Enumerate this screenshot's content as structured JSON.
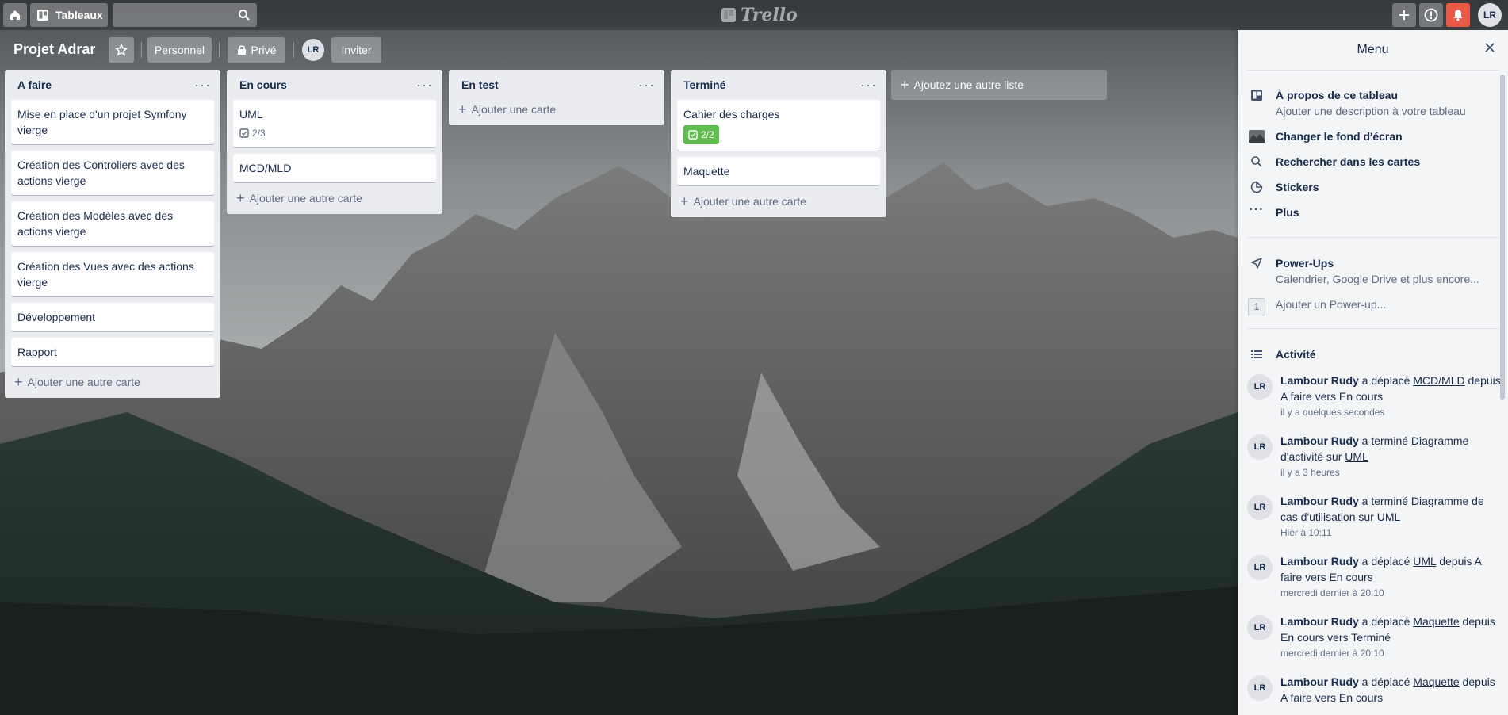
{
  "header": {
    "home_icon": "home-icon",
    "boards_label": "Tableaux",
    "search_value": "",
    "logo_text": "Trello",
    "user_initials": "LR"
  },
  "board": {
    "title": "Projet Adrar",
    "team_label": "Personnel",
    "visibility_label": "Privé",
    "member_initials": "LR",
    "invite_label": "Inviter"
  },
  "lists": [
    {
      "title": "A faire",
      "cards": [
        {
          "title": "Mise en place d'un projet Symfony vierge"
        },
        {
          "title": "Création des Controllers avec des actions vierge"
        },
        {
          "title": "Création des Modèles avec des actions vierge"
        },
        {
          "title": "Création des Vues avec des actions vierge"
        },
        {
          "title": "Développement"
        },
        {
          "title": "Rapport"
        }
      ],
      "add_card": "Ajouter une autre carte"
    },
    {
      "title": "En cours",
      "cards": [
        {
          "title": "UML",
          "checklist": "2/3"
        },
        {
          "title": "MCD/MLD"
        }
      ],
      "add_card": "Ajouter une autre carte"
    },
    {
      "title": "En test",
      "cards": [],
      "add_card": "Ajouter une carte"
    },
    {
      "title": "Terminé",
      "cards": [
        {
          "title": "Cahier des charges",
          "checklist_done": "2/2"
        },
        {
          "title": "Maquette"
        }
      ],
      "add_card": "Ajouter une autre carte"
    }
  ],
  "add_list_label": "Ajoutez une autre liste",
  "menu": {
    "title": "Menu",
    "about": {
      "label": "À propos de ce tableau",
      "sub": "Ajouter une description à votre tableau"
    },
    "background": "Changer le fond d'écran",
    "search_cards": "Rechercher dans les cartes",
    "stickers": "Stickers",
    "more": "Plus",
    "powerups": {
      "label": "Power-Ups",
      "sub": "Calendrier, Google Drive et plus encore..."
    },
    "add_powerup": {
      "count": "1",
      "label": "Ajouter un Power-up..."
    },
    "activity_label": "Activité",
    "activities": [
      {
        "user": "Lambour Rudy",
        "pre": " a déplacé ",
        "link": "MCD/MLD",
        "post": " depuis A faire vers En cours",
        "time": "il y a quelques secondes"
      },
      {
        "user": "Lambour Rudy",
        "pre": " a terminé Diagramme d'activité sur ",
        "link": "UML",
        "post": "",
        "time": "il y a 3 heures"
      },
      {
        "user": "Lambour Rudy",
        "pre": " a terminé Diagramme de cas d'utilisation sur ",
        "link": "UML",
        "post": "",
        "time": "Hier à 10:11"
      },
      {
        "user": "Lambour Rudy",
        "pre": " a déplacé ",
        "link": "UML",
        "post": " depuis A faire vers En cours",
        "time": "mercredi dernier à 20:10"
      },
      {
        "user": "Lambour Rudy",
        "pre": " a déplacé ",
        "link": "Maquette",
        "post": " depuis En cours vers Terminé",
        "time": "mercredi dernier à 20:10"
      },
      {
        "user": "Lambour Rudy",
        "pre": " a déplacé ",
        "link": "Maquette",
        "post": " depuis A faire vers En cours",
        "time": ""
      }
    ]
  },
  "colors": {
    "accent": "#61bd4f",
    "notification": "#eb5a46"
  }
}
